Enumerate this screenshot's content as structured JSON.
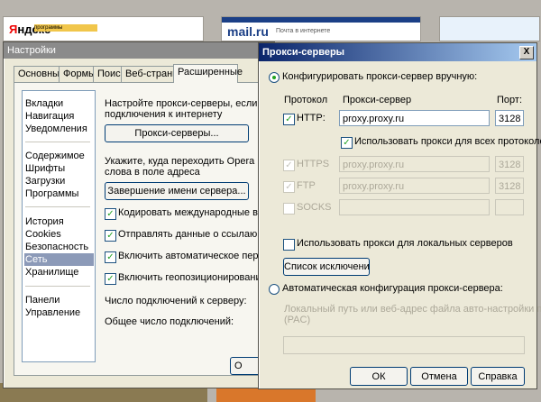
{
  "background": {
    "yandex_logo_prefix": "Я",
    "yandex_logo_rest": "ндекс",
    "yandex_strip": "программы",
    "mail_logo": "mail.ru",
    "mail_text": "Почта в интернете"
  },
  "settings": {
    "title": "Настройки",
    "tabs": [
      "Основные",
      "Формы",
      "Поиск",
      "Веб-страницы",
      "Расширенные"
    ],
    "sidebar": {
      "group1": [
        "Вкладки",
        "Навигация",
        "Уведомления"
      ],
      "group2": [
        "Содержимое",
        "Шрифты",
        "Загрузки",
        "Программы"
      ],
      "group3": [
        "История",
        "Cookies",
        "Безопасность",
        "Сеть",
        "Хранилище"
      ],
      "group4": [
        "Панели",
        "Управление"
      ]
    },
    "network": {
      "proxy_desc_1": "Настройте прокси-серверы, если не име",
      "proxy_desc_2": "подключения к интернету",
      "proxy_button": "Прокси-серверы...",
      "complete_desc_1": "Укажите, куда переходить Opera при вв",
      "complete_desc_2": "слова в поле адреса",
      "complete_button": "Завершение имени сервера...",
      "options": [
        "Кодировать международные веб-адр",
        "Отправлять данные о ссылающейся с",
        "Включить автоматическое перенапр",
        "Включить геопозиционирование"
      ],
      "conn_per_server": "Число подключений к серверу:",
      "conn_total": "Общее число подключений:",
      "ok_button": "О"
    }
  },
  "proxy": {
    "title": "Прокси-серверы",
    "close": "X",
    "manual_label": "Конфигурировать прокси-сервер вручную:",
    "col_protocol": "Протокол",
    "col_server": "Прокси-сервер",
    "col_port": "Порт:",
    "http_label": "HTTP:",
    "http_server": "proxy.proxy.ru",
    "http_port": "3128",
    "use_all_label": "Использовать прокси для всех протоколов",
    "https_label": "HTTPS",
    "https_server": "proxy.proxy.ru",
    "https_port": "3128",
    "ftp_label": "FTP",
    "ftp_server": "proxy.proxy.ru",
    "ftp_port": "3128",
    "socks_label": "SOCKS",
    "local_label": "Использовать прокси для локальных серверов",
    "exceptions_button": "Список исключений",
    "auto_label": "Автоматическая конфигурация прокси-сервера:",
    "auto_desc_1": "Локальный путь или веб-адрес файла авто-настройки прокси",
    "auto_desc_2": "(PAC)",
    "auto_value": "",
    "ok": "ОК",
    "cancel": "Отмена",
    "help": "Справка"
  }
}
